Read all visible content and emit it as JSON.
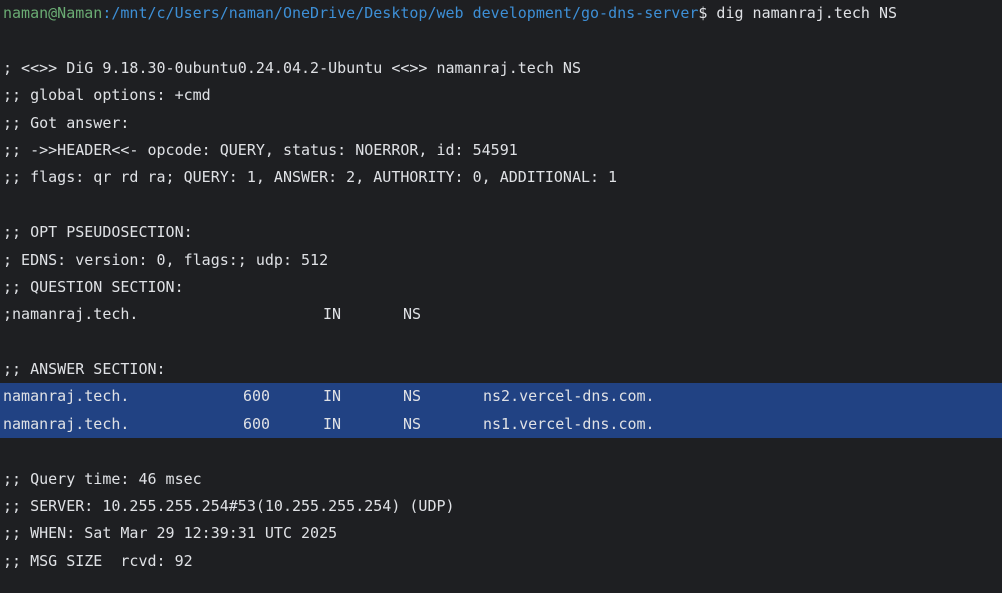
{
  "prompt": {
    "user_host": "naman@Naman",
    "path": ":/mnt/c/Users/naman/OneDrive/Desktop/web development/go-dns-server",
    "symbol": "$",
    "command": " dig namanraj.tech NS"
  },
  "header_lines": [
    "; <<>> DiG 9.18.30-0ubuntu0.24.04.2-Ubuntu <<>> namanraj.tech NS",
    ";; global options: +cmd",
    ";; Got answer:",
    ";; ->>HEADER<<- opcode: QUERY, status: NOERROR, id: 54591",
    ";; flags: qr rd ra; QUERY: 1, ANSWER: 2, AUTHORITY: 0, ADDITIONAL: 1"
  ],
  "opt_lines": [
    ";; OPT PSEUDOSECTION:",
    "; EDNS: version: 0, flags:; udp: 512",
    ";; QUESTION SECTION:"
  ],
  "question": {
    "name": ";namanraj.tech.",
    "class": "IN",
    "type": "NS"
  },
  "answer_header": ";; ANSWER SECTION:",
  "answers": [
    {
      "name": "namanraj.tech.",
      "ttl": "600",
      "class": "IN",
      "type": "NS",
      "data": "ns2.vercel-dns.com."
    },
    {
      "name": "namanraj.tech.",
      "ttl": "600",
      "class": "IN",
      "type": "NS",
      "data": "ns1.vercel-dns.com."
    }
  ],
  "footer_lines": [
    ";; Query time: 46 msec",
    ";; SERVER: 10.255.255.254#53(10.255.255.254) (UDP)",
    ";; WHEN: Sat Mar 29 12:39:31 UTC 2025",
    ";; MSG SIZE  rcvd: 92"
  ],
  "colors": {
    "background": "#1e1f22",
    "text": "#dfe1e5",
    "user": "#6aab73",
    "path": "#3d8fd6",
    "selection": "#214283"
  }
}
